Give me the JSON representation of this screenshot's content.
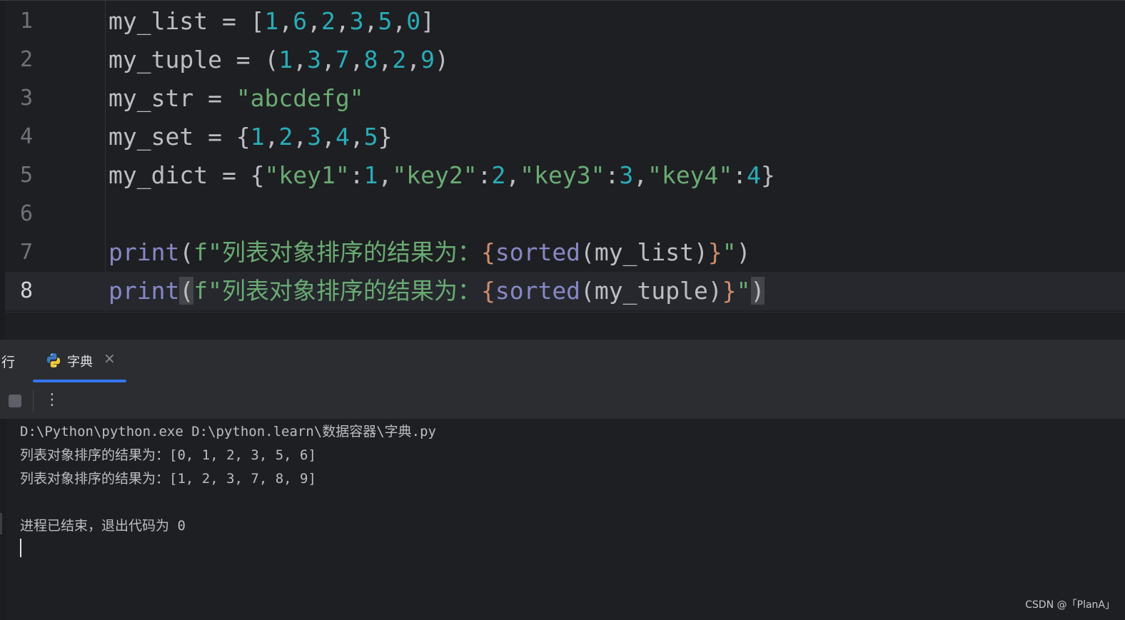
{
  "editor": {
    "lines": [
      {
        "num": "1",
        "tokens": [
          {
            "t": "my_list = [",
            "c": ""
          },
          {
            "t": "1",
            "c": "num"
          },
          {
            "t": ",",
            "c": ""
          },
          {
            "t": "6",
            "c": "num"
          },
          {
            "t": ",",
            "c": ""
          },
          {
            "t": "2",
            "c": "num"
          },
          {
            "t": ",",
            "c": ""
          },
          {
            "t": "3",
            "c": "num"
          },
          {
            "t": ",",
            "c": ""
          },
          {
            "t": "5",
            "c": "num"
          },
          {
            "t": ",",
            "c": ""
          },
          {
            "t": "0",
            "c": "num"
          },
          {
            "t": "]",
            "c": ""
          }
        ]
      },
      {
        "num": "2",
        "tokens": [
          {
            "t": "my_tuple = (",
            "c": ""
          },
          {
            "t": "1",
            "c": "num"
          },
          {
            "t": ",",
            "c": ""
          },
          {
            "t": "3",
            "c": "num"
          },
          {
            "t": ",",
            "c": ""
          },
          {
            "t": "7",
            "c": "num"
          },
          {
            "t": ",",
            "c": ""
          },
          {
            "t": "8",
            "c": "num"
          },
          {
            "t": ",",
            "c": ""
          },
          {
            "t": "2",
            "c": "num"
          },
          {
            "t": ",",
            "c": ""
          },
          {
            "t": "9",
            "c": "num"
          },
          {
            "t": ")",
            "c": ""
          }
        ]
      },
      {
        "num": "3",
        "tokens": [
          {
            "t": "my_str = ",
            "c": ""
          },
          {
            "t": "\"abcdefg\"",
            "c": "str"
          }
        ]
      },
      {
        "num": "4",
        "tokens": [
          {
            "t": "my_set = {",
            "c": ""
          },
          {
            "t": "1",
            "c": "num"
          },
          {
            "t": ",",
            "c": ""
          },
          {
            "t": "2",
            "c": "num"
          },
          {
            "t": ",",
            "c": ""
          },
          {
            "t": "3",
            "c": "num"
          },
          {
            "t": ",",
            "c": ""
          },
          {
            "t": "4",
            "c": "num"
          },
          {
            "t": ",",
            "c": ""
          },
          {
            "t": "5",
            "c": "num"
          },
          {
            "t": "}",
            "c": ""
          }
        ]
      },
      {
        "num": "5",
        "tokens": [
          {
            "t": "my_dict = {",
            "c": ""
          },
          {
            "t": "\"key1\"",
            "c": "str"
          },
          {
            "t": ":",
            "c": ""
          },
          {
            "t": "1",
            "c": "num"
          },
          {
            "t": ",",
            "c": ""
          },
          {
            "t": "\"key2\"",
            "c": "str"
          },
          {
            "t": ":",
            "c": ""
          },
          {
            "t": "2",
            "c": "num"
          },
          {
            "t": ",",
            "c": ""
          },
          {
            "t": "\"key3\"",
            "c": "str"
          },
          {
            "t": ":",
            "c": ""
          },
          {
            "t": "3",
            "c": "num"
          },
          {
            "t": ",",
            "c": ""
          },
          {
            "t": "\"key4\"",
            "c": "str"
          },
          {
            "t": ":",
            "c": ""
          },
          {
            "t": "4",
            "c": "num"
          },
          {
            "t": "}",
            "c": ""
          }
        ]
      },
      {
        "num": "6",
        "tokens": []
      },
      {
        "num": "7",
        "tokens": [
          {
            "t": "print",
            "c": "fn"
          },
          {
            "t": "(",
            "c": ""
          },
          {
            "t": "f\"列表对象排序的结果为：",
            "c": "str"
          },
          {
            "t": "{",
            "c": "brace"
          },
          {
            "t": "sorted",
            "c": "fn"
          },
          {
            "t": "(my_list)",
            "c": ""
          },
          {
            "t": "}",
            "c": "brace"
          },
          {
            "t": "\"",
            "c": "str"
          },
          {
            "t": ")",
            "c": ""
          }
        ]
      },
      {
        "num": "8",
        "current": true,
        "tokens": [
          {
            "t": "print",
            "c": "fn"
          },
          {
            "t": "(",
            "c": "paren-hl"
          },
          {
            "t": "f\"列表对象排序的结果为：",
            "c": "str"
          },
          {
            "t": "{",
            "c": "brace"
          },
          {
            "t": "sorted",
            "c": "fn"
          },
          {
            "t": "(my_tuple)",
            "c": ""
          },
          {
            "t": "}",
            "c": "brace"
          },
          {
            "t": "\"",
            "c": "str"
          },
          {
            "t": ")",
            "c": "paren-hl"
          }
        ]
      }
    ]
  },
  "toolwindow": {
    "run_label": "行",
    "tab_label": "字典",
    "tab_close": "×",
    "more_glyph": "⋮"
  },
  "console": {
    "lines": [
      "D:\\Python\\python.exe D:\\python.learn\\数据容器\\字典.py",
      "列表对象排序的结果为：[0, 1, 2, 3, 5, 6]",
      "列表对象排序的结果为：[1, 2, 3, 7, 8, 9]",
      "",
      "进程已结束，退出代码为 0"
    ]
  },
  "watermark": "CSDN @「PlanA」",
  "colors": {
    "accent": "#3574f0",
    "number": "#2aacb8",
    "string": "#6aab73",
    "builtin": "#8888c6",
    "fstring_brace": "#cf8e6d"
  }
}
